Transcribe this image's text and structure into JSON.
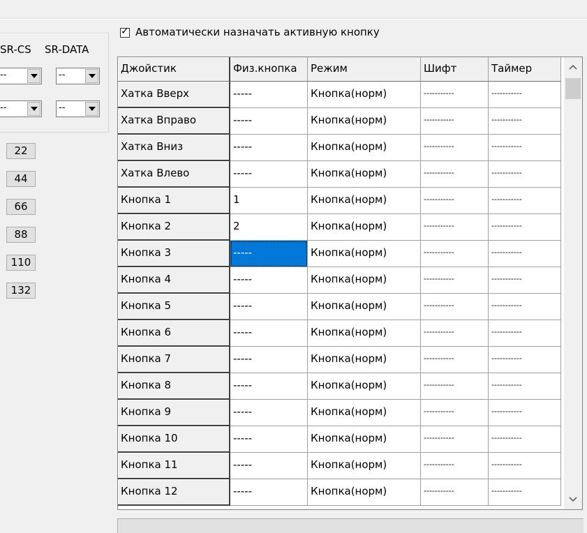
{
  "sr": {
    "headers": [
      "SR-CS",
      "SR-DATA"
    ],
    "combo_values": [
      "--",
      "--",
      "--",
      "--"
    ]
  },
  "number_buttons": [
    "22",
    "44",
    "66",
    "88",
    "110",
    "132"
  ],
  "auto_assign": {
    "checked": true,
    "label": "Автоматически назначать активную кнопку"
  },
  "grid": {
    "columns": [
      "Джойстик",
      "Физ.кнопка",
      "Режим",
      "Шифт",
      "Таймер"
    ],
    "rows": [
      [
        "Хатка Вверх",
        "-----",
        "Кнопка(норм)",
        "-----------",
        "-----------"
      ],
      [
        "Хатка Вправо",
        "-----",
        "Кнопка(норм)",
        "-----------",
        "-----------"
      ],
      [
        "Хатка Вниз",
        "-----",
        "Кнопка(норм)",
        "-----------",
        "-----------"
      ],
      [
        "Хатка Влево",
        "-----",
        "Кнопка(норм)",
        "-----------",
        "-----------"
      ],
      [
        "Кнопка 1",
        "1",
        "Кнопка(норм)",
        "-----------",
        "-----------"
      ],
      [
        "Кнопка 2",
        "2",
        "Кнопка(норм)",
        "-----------",
        "-----------"
      ],
      [
        "Кнопка 3",
        "-----",
        "Кнопка(норм)",
        "-----------",
        "-----------"
      ],
      [
        "Кнопка 4",
        "-----",
        "Кнопка(норм)",
        "-----------",
        "-----------"
      ],
      [
        "Кнопка 5",
        "-----",
        "Кнопка(норм)",
        "-----------",
        "-----------"
      ],
      [
        "Кнопка 6",
        "-----",
        "Кнопка(норм)",
        "-----------",
        "-----------"
      ],
      [
        "Кнопка 7",
        "-----",
        "Кнопка(норм)",
        "-----------",
        "-----------"
      ],
      [
        "Кнопка 8",
        "-----",
        "Кнопка(норм)",
        "-----------",
        "-----------"
      ],
      [
        "Кнопка 9",
        "-----",
        "Кнопка(норм)",
        "-----------",
        "-----------"
      ],
      [
        "Кнопка 10",
        "-----",
        "Кнопка(норм)",
        "-----------",
        "-----------"
      ],
      [
        "Кнопка 11",
        "-----",
        "Кнопка(норм)",
        "-----------",
        "-----------"
      ],
      [
        "Кнопка 12",
        "-----",
        "Кнопка(норм)",
        "-----------",
        "-----------"
      ]
    ],
    "selected_row": 6,
    "selected_col": 1,
    "selection_color": "#0078d7"
  },
  "scrollbar": {
    "up_icon": "chevron-up-icon",
    "down_icon": "chevron-down-icon"
  }
}
